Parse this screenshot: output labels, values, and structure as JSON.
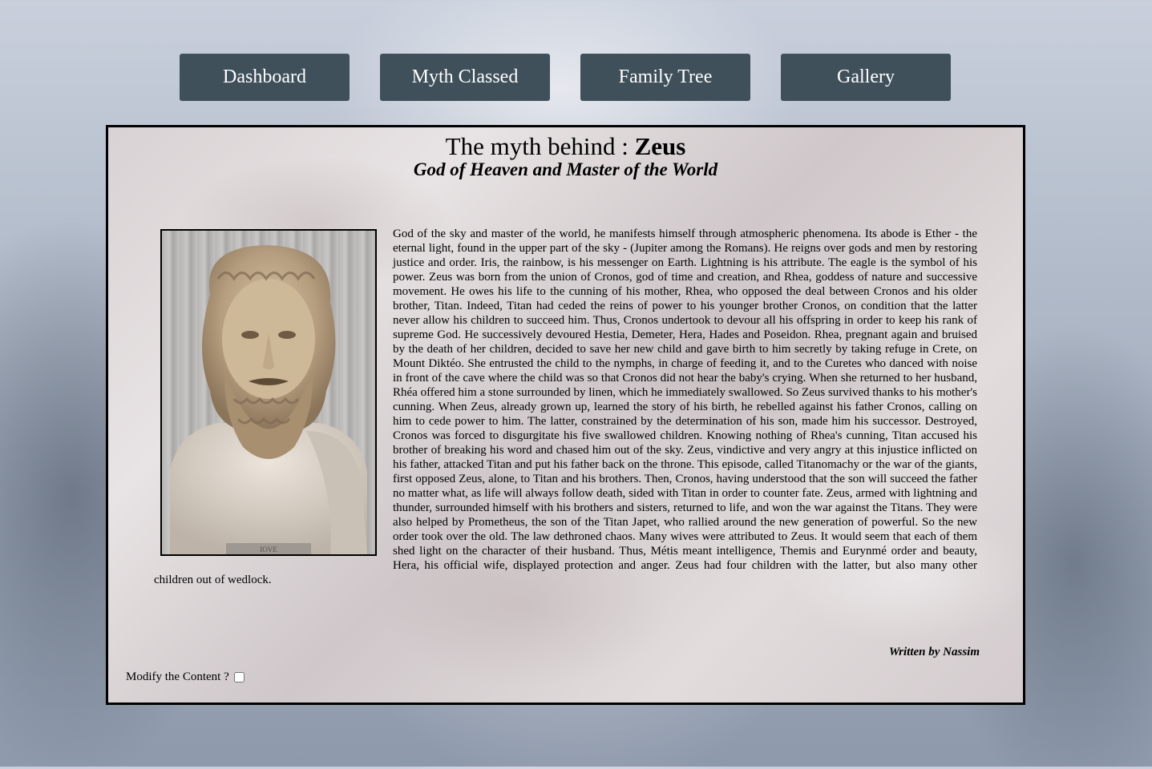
{
  "nav": {
    "dashboard": "Dashboard",
    "myth_classed": "Myth Classed",
    "family_tree": "Family Tree",
    "gallery": "Gallery"
  },
  "article": {
    "title_prefix": "The myth behind :",
    "title_name": "Zeus",
    "subtitle": "God of Heaven and Master of the World",
    "image_plaque": "IOVE",
    "body": "God of the sky and master of the world, he manifests himself through atmospheric phenomena. Its abode is Ether - the eternal light, found in the upper part of the sky - (Jupiter among the Romans). He reigns over gods and men by restoring justice and order. Iris, the rainbow, is his messenger on Earth. Lightning is his attribute. The eagle is the symbol of his power. Zeus was born from the union of Cronos, god of time and creation, and Rhea, goddess of nature and successive movement. He owes his life to the cunning of his mother, Rhea, who opposed the deal between Cronos and his older brother, Titan. Indeed, Titan had ceded the reins of power to his younger brother Cronos, on condition that the latter never allow his children to succeed him. Thus, Cronos undertook to devour all his offspring in order to keep his rank of supreme God. He successively devoured Hestia, Demeter, Hera, Hades and Poseidon. Rhea, pregnant again and bruised by the death of her children, decided to save her new child and gave birth to him secretly by taking refuge in Crete, on Mount Diktéo. She entrusted the child to the nymphs, in charge of feeding it, and to the Curetes who danced with noise in front of the cave where the child was so that Cronos did not hear the baby's crying. When she returned to her husband, Rhéa offered him a stone surrounded by linen, which he immediately swallowed. So Zeus survived thanks to his mother's cunning. When Zeus, already grown up, learned the story of his birth, he rebelled against his father Cronos, calling on him to cede power to him. The latter, constrained by the determination of his son, made him his successor. Destroyed, Cronos was forced to disgurgitate his five swallowed children. Knowing nothing of Rhea's cunning, Titan accused his brother of breaking his word and chased him out of the sky. Zeus, vindictive and very angry at this injustice inflicted on his father, attacked Titan and put his father back on the throne. This episode, called Titanomachy or the war of the giants, first opposed Zeus, alone, to Titan and his brothers. Then, Cronos, having understood that the son will succeed the father no matter what, as life will always follow death, sided with Titan in order to counter fate. Zeus, armed with lightning and thunder, surrounded himself with his brothers and sisters, returned to life, and won the war against the Titans. They were also helped by Prometheus, the son of the Titan Japet, who rallied around the new generation of powerful. So the new order took over the old. The law dethroned chaos. Many wives were attributed to Zeus. It would seem that each of them shed light on the character of their husband. Thus, Métis meant intelligence, Themis and Eurynmé order and beauty, Hera, his official wife, displayed protection and anger. Zeus had four children with the latter, but also many other children out of wedlock.",
    "signature": "Written by Nassim"
  },
  "modify": {
    "label": "Modify the Content ?",
    "checked": false
  },
  "colors": {
    "nav_button_bg": "#3f505b",
    "nav_button_text": "#ffffff",
    "panel_border": "#000000"
  }
}
